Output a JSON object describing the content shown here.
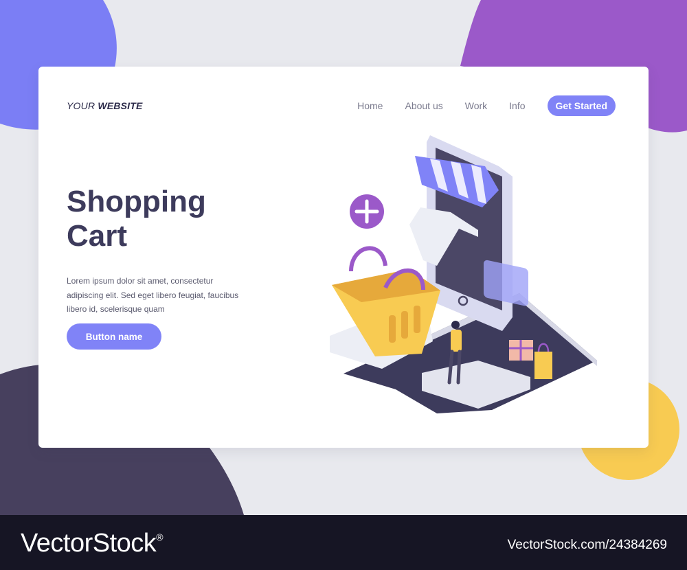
{
  "logo": {
    "prefix": "YOUR",
    "bold": "WEBSITE"
  },
  "nav": {
    "items": [
      {
        "label": "Home"
      },
      {
        "label": "About us"
      },
      {
        "label": "Work"
      },
      {
        "label": "Info"
      }
    ],
    "cta_label": "Get Started"
  },
  "hero": {
    "title_line1": "Shopping",
    "title_line2": "Cart",
    "body": "Lorem ipsum dolor sit amet, consectetur adipiscing elit. Sed eget libero feugiat, faucibus libero id, scelerisque quam",
    "button_label": "Button name"
  },
  "footer": {
    "brand": "VectorStock",
    "registered_mark": "®",
    "image_id": "VectorStock.com/24384269"
  },
  "colors": {
    "accent": "#8083f7",
    "heading": "#3d3b5c",
    "blob_blue": "#7b7ef5",
    "blob_purple": "#9b59c9",
    "blob_dark": "#47405e",
    "blob_yellow": "#f8cb52",
    "footer_bg": "#161524"
  }
}
